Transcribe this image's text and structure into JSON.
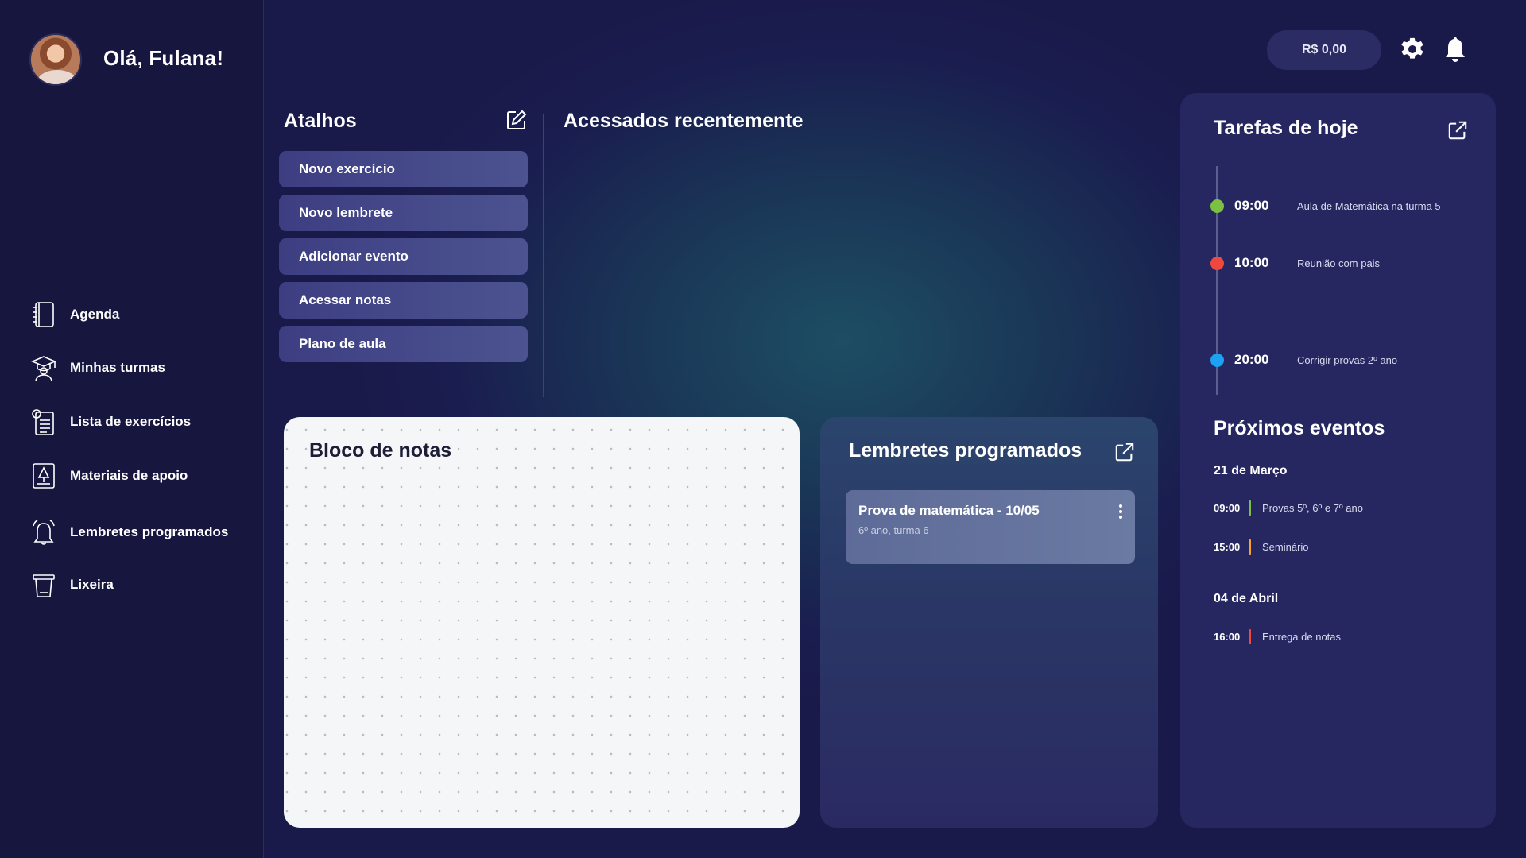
{
  "user": {
    "greeting": "Olá, Fulana!"
  },
  "sidebar": {
    "items": [
      {
        "label": "Agenda",
        "icon": "agenda-icon"
      },
      {
        "label": "Minhas turmas",
        "icon": "graduation-icon"
      },
      {
        "label": "Lista de exercícios",
        "icon": "exercise-list-icon"
      },
      {
        "label": "Materiais de apoio",
        "icon": "support-material-icon"
      },
      {
        "label": "Lembretes programados",
        "icon": "bell-icon"
      },
      {
        "label": "Lixeira",
        "icon": "trash-icon"
      }
    ]
  },
  "header": {
    "balance": "R$ 0,00"
  },
  "shortcuts": {
    "title": "Atalhos",
    "items": [
      "Novo exercício",
      "Novo lembrete",
      "Adicionar evento",
      "Acessar notas",
      "Plano de aula"
    ]
  },
  "recent": {
    "title": "Acessados recentemente"
  },
  "notepad": {
    "title": "Bloco de notas"
  },
  "reminders": {
    "title": "Lembretes programados",
    "items": [
      {
        "title": "Prova de matemática - 10/05",
        "subtitle": "6º ano, turma 6"
      }
    ]
  },
  "tasks": {
    "title": "Tarefas de hoje",
    "items": [
      {
        "time": "09:00",
        "desc": "Aula de Matemática na turma 5",
        "color": "#7cc142"
      },
      {
        "time": "10:00",
        "desc": "Reunião com pais",
        "color": "#f0483e"
      },
      {
        "time": "20:00",
        "desc": "Corrigir provas 2º ano",
        "color": "#1da1f2"
      }
    ]
  },
  "events": {
    "title": "Próximos eventos",
    "groups": [
      {
        "date": "21 de Março",
        "items": [
          {
            "time": "09:00",
            "desc": "Provas 5º, 6º e 7º ano",
            "color": "#7cc142"
          },
          {
            "time": "15:00",
            "desc": "Seminário",
            "color": "#f5a623"
          }
        ]
      },
      {
        "date": "04 de Abril",
        "items": [
          {
            "time": "16:00",
            "desc": "Entrega de notas",
            "color": "#f0483e"
          }
        ]
      }
    ]
  },
  "colors": {
    "background": "#1a1a4a",
    "sidebar": "#16163f",
    "shortcut_button": "#444887",
    "panel": "#262760",
    "notepad": "#f4f6f7"
  }
}
